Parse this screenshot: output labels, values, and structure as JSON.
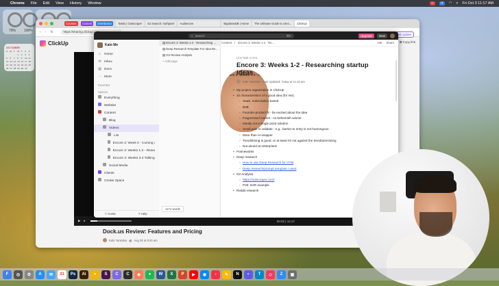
{
  "menubar": {
    "app": "Chrome",
    "items": [
      "File",
      "Edit",
      "View",
      "History",
      "Window"
    ],
    "badges": [
      {
        "label": "C",
        "color": "#e0393e"
      },
      {
        "label": "IT",
        "color": "#3a7be0"
      }
    ],
    "clock": "Fri Oct 3 11:17 AM"
  },
  "widgets": {
    "ring1": "79%",
    "ring2": "100%",
    "calendar_month": "OCTOBER",
    "calendar_days": [
      "S",
      "M",
      "T",
      "W",
      "T",
      "F",
      "S",
      "",
      "",
      "",
      "1",
      "2",
      "3",
      "4",
      "5",
      "6",
      "7",
      "8",
      "9",
      "10",
      "11",
      "12",
      "13",
      "14",
      "15",
      "16",
      "17",
      "18",
      "19",
      "20",
      "21",
      "22",
      "23",
      "24",
      "25",
      "26",
      "27",
      "28",
      "29",
      "30",
      "31"
    ]
  },
  "browser": {
    "tabs": [
      {
        "tag": "Courses",
        "tag_color": "#e0393e"
      },
      {
        "tag": "Content",
        "tag_color": "#7b3fe4"
      },
      {
        "tag": "Distribution",
        "tag_color": "#2a7be0"
      },
      {
        "label": "Tasks | Outscraper"
      },
      {
        "label": "G2 Search: truthpixel"
      },
      {
        "label": "Audiences"
      },
      {
        "label": "BigIdeasDB | Home"
      },
      {
        "label": "The Ultimate Guide to Umo..."
      },
      {
        "label": "ClickUp"
      }
    ],
    "url": "https://sharing.clickup.com",
    "brand": "ClickUp",
    "copy_link": "Copy link",
    "finish_update": "Finish update",
    "video_time": "00:02 | 12:17",
    "article_title": "Dock.us Review: Features and Pricing",
    "article_author": "Kalo Yankulov",
    "article_date": "Aug 26 at 9:40 am"
  },
  "clickup": {
    "search_placeholder": "Search",
    "search_shortcut": "⌘K",
    "upgrade": "Upgrade",
    "new": "New",
    "workspace": "Kalo Me",
    "nav": [
      {
        "icon": "⌂",
        "label": "Home"
      },
      {
        "icon": "✉",
        "label": "Inbox"
      },
      {
        "icon": "▤",
        "label": "Docs"
      },
      {
        "icon": "⋯",
        "label": "More"
      }
    ],
    "favorites_label": "Favorites",
    "spaces_label": "Spaces",
    "spaces": [
      {
        "label": "Everything",
        "indent": 0,
        "color": "#999"
      },
      {
        "label": "Website",
        "indent": 0,
        "color": "#7b68ee"
      },
      {
        "label": "Content",
        "indent": 0,
        "color": "#e0393e"
      },
      {
        "label": "Blog",
        "indent": 1,
        "color": "#999"
      },
      {
        "label": "Videos",
        "indent": 1,
        "color": "#999",
        "selected": true
      },
      {
        "label": "List",
        "indent": 2,
        "color": "#999"
      },
      {
        "label": "Encore 2: Week 0 - Coming up with a...",
        "indent": 2,
        "color": "#999"
      },
      {
        "label": "Encore 3: Weeks 1-2 - Researching st...",
        "indent": 2,
        "color": "#999"
      },
      {
        "label": "Encore 3: Weeks 3-4 Talking to people",
        "indent": 2,
        "color": "#999"
      },
      {
        "label": "Social Media",
        "indent": 1,
        "color": "#999"
      },
      {
        "label": "Clients",
        "indent": 0,
        "color": "#7b3fe4"
      },
      {
        "label": "Create Space",
        "indent": 0,
        "color": "#999"
      }
    ],
    "invite": "Invite",
    "help": "Help",
    "pages_header": "Encore 3: Weeks 1-2 - Researchin...",
    "pages": [
      {
        "label": "Encore 3: Weeks 1-2 - Researching ...",
        "selected": true
      },
      {
        "label": "Deep Research Template For Idea Re..."
      },
      {
        "label": "G2 Review Analysis"
      }
    ],
    "add_page": "+ Add page",
    "word_count": "1171 words",
    "breadcrumb": [
      "Content",
      "Encore 3: Weeks 1-2 - Re..."
    ],
    "crumb_right": [
      "Ask",
      "Share"
    ],
    "link_task": "Link Task or Doc",
    "doc_title": "Encore 3: Weeks 1-2  - Researching startup ideas",
    "doc_author": "Kalo Yankulov",
    "doc_updated": "Last Updated:  Today at 11:16 am",
    "bullets": [
      {
        "text": "My project organization in ClickUp",
        "level": 1
      },
      {
        "text": "10 characteristics of a good idea (for me):",
        "level": 1
      },
      {
        "text": "SaaS, subscription-based",
        "level": 2
      },
      {
        "text": "B2B",
        "level": 2
      },
      {
        "text": "Founder-product fit - be excited about the idea",
        "level": 2
      },
      {
        "text": "Fragmented market - no behemoth winner",
        "level": 2
      },
      {
        "text": "Ideally not a single point solution",
        "level": 2
      },
      {
        "text": "Small pain to validate - e.g., barrier to entry is not humongous",
        "level": 2
      },
      {
        "text": "More than AI wrapper",
        "level": 2
      },
      {
        "text": "Trend/timing is good, or at least it's not against the trend/anti-timing",
        "level": 2
      },
      {
        "text": "Not aimed at enterprises",
        "level": 2
      },
      {
        "text": "Frameworks",
        "level": 1
      },
      {
        "text": "Deep research",
        "level": 1
      },
      {
        "text": "How to use Deep Research for GTM",
        "level": 2,
        "link": true
      },
      {
        "text": "Deep research/prompt template I used",
        "level": 2,
        "link": true
      },
      {
        "text": "G2 Analysis",
        "level": 1
      },
      {
        "text": "https://outscraper.com/",
        "level": 2,
        "link": true
      },
      {
        "text": "P25: G2R example",
        "level": 2
      },
      {
        "text": "Reddit research",
        "level": 1
      }
    ]
  },
  "dock": [
    {
      "label": "F",
      "color": "#3b82f6"
    },
    {
      "label": "◎",
      "color": "#555"
    },
    {
      "label": "⚙",
      "color": "#888"
    },
    {
      "label": "A",
      "color": "#1e90ff"
    },
    {
      "label": "✉",
      "color": "#4aa3ff"
    },
    {
      "label": "31",
      "color": "#ffffff"
    },
    {
      "label": "Ps",
      "color": "#0b2a4a"
    },
    {
      "label": "Ai",
      "color": "#3a1f00"
    },
    {
      "label": "●",
      "color": "#f4b400"
    },
    {
      "label": "S",
      "color": "#4a154b"
    },
    {
      "label": "C",
      "color": "#7b68ee"
    },
    {
      "label": "C",
      "color": "#2d2d2d"
    },
    {
      "label": "◆",
      "color": "#ff7a59"
    },
    {
      "label": "●",
      "color": "#1db954"
    },
    {
      "label": "W",
      "color": "#2b579a"
    },
    {
      "label": "X",
      "color": "#217346"
    },
    {
      "label": "P",
      "color": "#d24726"
    },
    {
      "label": "▶",
      "color": "#ff0000"
    },
    {
      "label": "◉",
      "color": "#0a84ff"
    },
    {
      "label": "♪",
      "color": "#fa2d48"
    },
    {
      "label": "✎",
      "color": "#ffb800"
    },
    {
      "label": "N",
      "color": "#111111"
    },
    {
      "label": "◐",
      "color": "#5e5ce6"
    },
    {
      "label": "T",
      "color": "#0088cc"
    },
    {
      "label": "◇",
      "color": "#ff375f"
    },
    {
      "label": "Z",
      "color": "#2d8cff"
    },
    {
      "label": "▣",
      "color": "#6e6e73"
    }
  ]
}
